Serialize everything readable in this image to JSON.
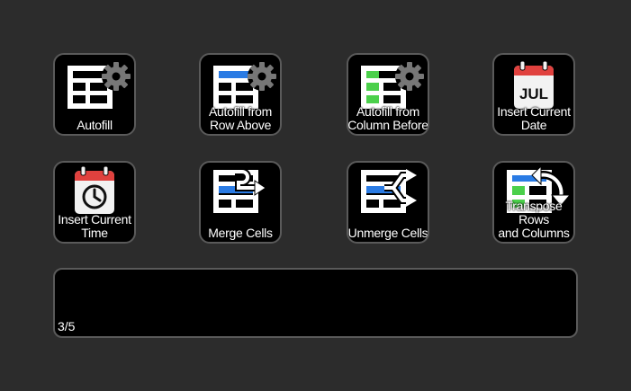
{
  "keys": [
    {
      "label": "Autofill",
      "icon": "table-gear-icon"
    },
    {
      "label": "Autofill from\nRow Above",
      "icon": "table-row-gear-icon"
    },
    {
      "label": "Autofill from\nColumn Before",
      "icon": "table-column-gear-icon"
    },
    {
      "label": "Insert Current\nDate",
      "icon": "calendar-jul-icon",
      "calendar_text": "JUL"
    },
    {
      "label": "Insert Current\nTime",
      "icon": "calendar-clock-icon"
    },
    {
      "label": "Merge Cells",
      "icon": "merge-cells-icon"
    },
    {
      "label": "Unmerge Cells",
      "icon": "unmerge-cells-icon"
    },
    {
      "label": "Transpose Rows\nand Columns",
      "icon": "transpose-icon"
    }
  ],
  "info_panel": {
    "page_indicator": "3/5"
  },
  "colors": {
    "background": "#2c2c2c",
    "blue": "#2a7be4",
    "green": "#4bd04b",
    "red": "#e0413e"
  }
}
